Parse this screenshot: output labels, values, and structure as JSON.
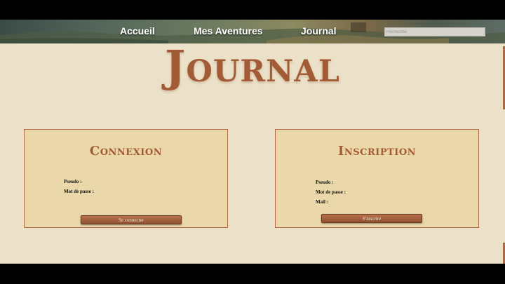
{
  "nav": {
    "links": [
      "Accueil",
      "Mes Aventures",
      "Journal"
    ],
    "search_placeholder": "Recherche"
  },
  "page_title": "Journal",
  "connexion": {
    "title": "Connexion",
    "pseudo_label": "Pseudo :",
    "password_label": "Mot de passe :",
    "submit_label": "Se connecter"
  },
  "inscription": {
    "title": "Inscription",
    "pseudo_label": "Pseudo :",
    "password_label": "Mot de passe :",
    "mail_label": "Mail :",
    "submit_label": "S'inscrire"
  },
  "colors": {
    "accent": "#a35b36",
    "panel": "#ead8aa",
    "background": "#ebe1c8"
  }
}
